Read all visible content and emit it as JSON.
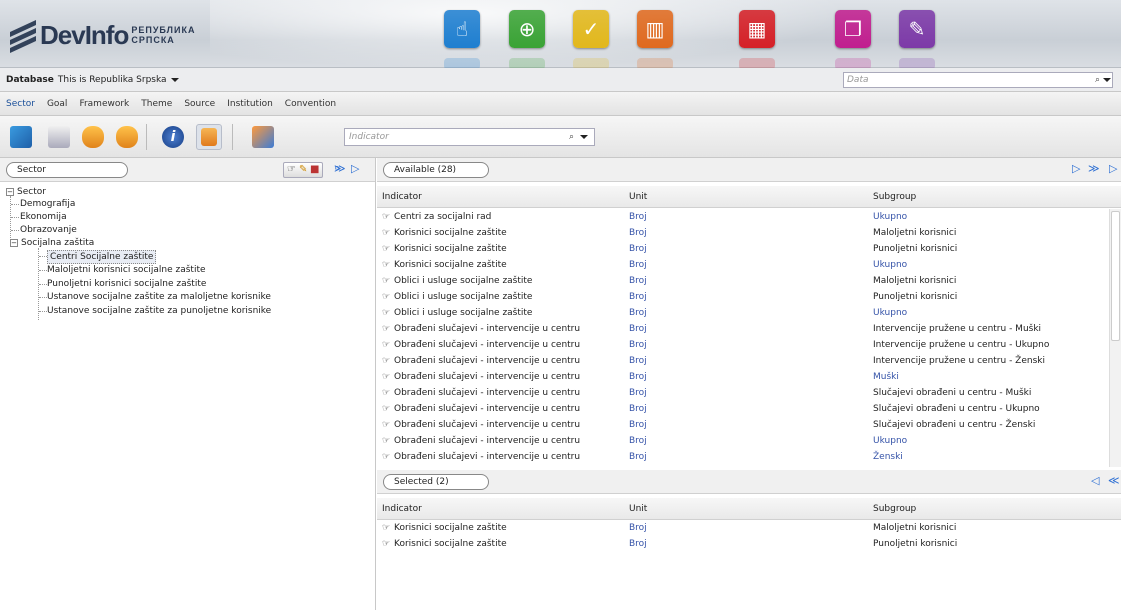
{
  "brand": {
    "logo_text": "DevInfo",
    "logo_sub_line1": "РЕПУБЛИКА",
    "logo_sub_line2": "СРПСКА"
  },
  "app_icons": [
    {
      "name": "touch",
      "color": "#1f7fd0",
      "glyph": "☝"
    },
    {
      "name": "globe",
      "color": "#3aa335",
      "glyph": "⊕"
    },
    {
      "name": "check",
      "color": "#e2b81c",
      "glyph": "✓"
    },
    {
      "name": "bars",
      "color": "#e06a1f",
      "glyph": "▥"
    },
    {
      "name": "grid",
      "color": "#d52027",
      "glyph": "▦"
    },
    {
      "name": "windows",
      "color": "#c11f8f",
      "glyph": "❐"
    },
    {
      "name": "document",
      "color": "#7d3aa8",
      "glyph": "✎"
    }
  ],
  "database": {
    "label": "Database",
    "value": "This is Republika Srpska",
    "search_placeholder": "Data"
  },
  "menu": {
    "active": "Sector",
    "items": [
      "Sector",
      "Goal",
      "Framework",
      "Theme",
      "Source",
      "Institution",
      "Convention"
    ]
  },
  "toolbar": {
    "indicator_placeholder": "Indicator"
  },
  "left": {
    "title": "Sector",
    "tree": {
      "root": "Sector",
      "children": [
        "Demografija",
        "Ekonomija",
        "Obrazovanje"
      ],
      "expanded": "Socijalna zaštita",
      "sub": [
        "Centri Socijalne zaštite",
        "Maloljetni korisnici socijalne zaštite",
        "Punoljetni korisnici socijalne zaštite",
        "Ustanove socijalne zaštite za maloljetne korisnike",
        "Ustanove socijalne zaštite za punoljetne korisnike"
      ]
    }
  },
  "available": {
    "title": "Available (28)",
    "columns": [
      "Indicator",
      "Unit",
      "Subgroup"
    ],
    "rows": [
      {
        "indicator": "Centri za socijalni rad",
        "unit": "Broj",
        "subgroup": "Ukupno",
        "sub_link": true
      },
      {
        "indicator": "Korisnici socijalne zaštite",
        "unit": "Broj",
        "subgroup": "Maloljetni korisnici",
        "sub_link": false
      },
      {
        "indicator": "Korisnici socijalne zaštite",
        "unit": "Broj",
        "subgroup": "Punoljetni korisnici",
        "sub_link": false
      },
      {
        "indicator": "Korisnici socijalne zaštite",
        "unit": "Broj",
        "subgroup": "Ukupno",
        "sub_link": true
      },
      {
        "indicator": "Oblici i usluge socijalne zaštite",
        "unit": "Broj",
        "subgroup": "Maloljetni korisnici",
        "sub_link": false
      },
      {
        "indicator": "Oblici i usluge socijalne zaštite",
        "unit": "Broj",
        "subgroup": "Punoljetni korisnici",
        "sub_link": false
      },
      {
        "indicator": "Oblici i usluge socijalne zaštite",
        "unit": "Broj",
        "subgroup": "Ukupno",
        "sub_link": true
      },
      {
        "indicator": "Obrađeni slučajevi - intervencije u centru",
        "unit": "Broj",
        "subgroup": "Intervencije pružene u centru - Muški",
        "sub_link": false
      },
      {
        "indicator": "Obrađeni slučajevi - intervencije u centru",
        "unit": "Broj",
        "subgroup": "Intervencije pružene u centru - Ukupno",
        "sub_link": false
      },
      {
        "indicator": "Obrađeni slučajevi - intervencije u centru",
        "unit": "Broj",
        "subgroup": "Intervencije pružene u centru - Ženski",
        "sub_link": false
      },
      {
        "indicator": "Obrađeni slučajevi - intervencije u centru",
        "unit": "Broj",
        "subgroup": "Muški",
        "sub_link": true
      },
      {
        "indicator": "Obrađeni slučajevi - intervencije u centru",
        "unit": "Broj",
        "subgroup": "Slučajevi obrađeni u centru - Muški",
        "sub_link": false
      },
      {
        "indicator": "Obrađeni slučajevi - intervencije u centru",
        "unit": "Broj",
        "subgroup": "Slučajevi obrađeni u centru - Ukupno",
        "sub_link": false
      },
      {
        "indicator": "Obrađeni slučajevi - intervencije u centru",
        "unit": "Broj",
        "subgroup": "Slučajevi obrađeni u centru - Ženski",
        "sub_link": false
      },
      {
        "indicator": "Obrađeni slučajevi - intervencije u centru",
        "unit": "Broj",
        "subgroup": "Ukupno",
        "sub_link": true
      },
      {
        "indicator": "Obrađeni slučajevi - intervencije u centru",
        "unit": "Broj",
        "subgroup": "Ženski",
        "sub_link": true
      }
    ]
  },
  "selected": {
    "title": "Selected (2)",
    "columns": [
      "Indicator",
      "Unit",
      "Subgroup"
    ],
    "rows": [
      {
        "indicator": "Korisnici socijalne zaštite",
        "unit": "Broj",
        "subgroup": "Maloljetni korisnici"
      },
      {
        "indicator": "Korisnici socijalne zaštite",
        "unit": "Broj",
        "subgroup": "Punoljetni korisnici"
      }
    ]
  }
}
